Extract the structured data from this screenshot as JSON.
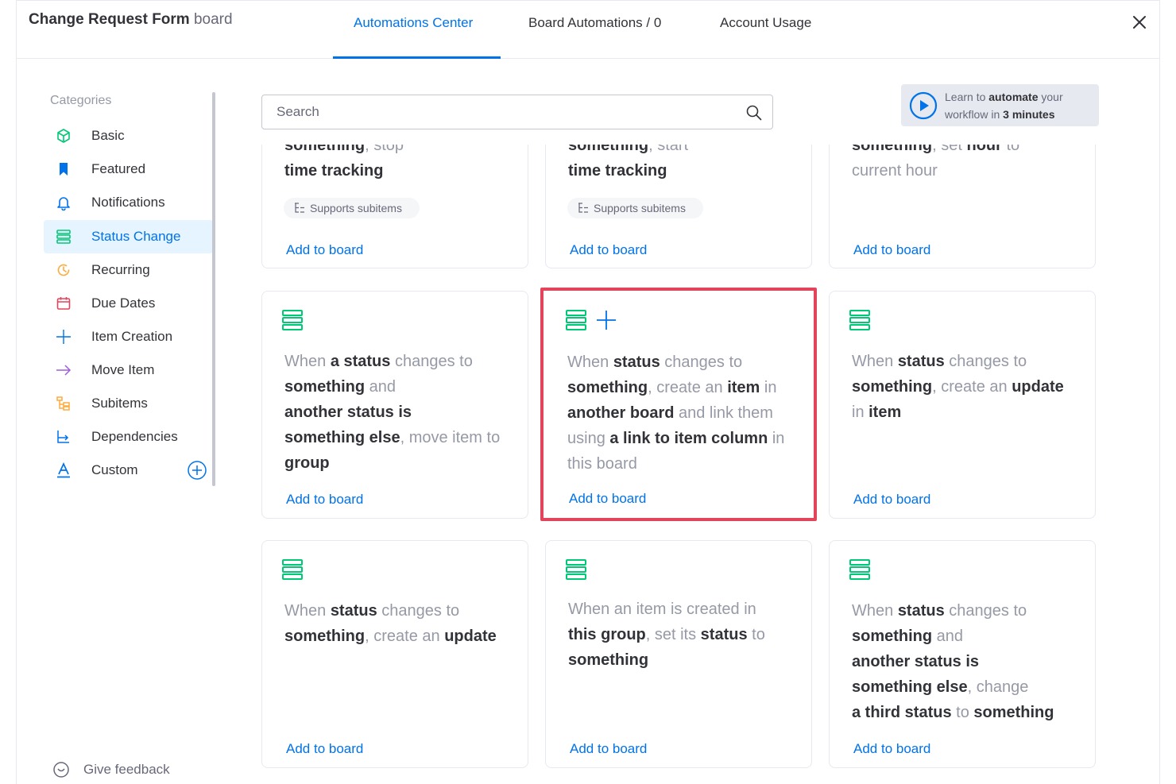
{
  "header": {
    "board_name": "Change Request Form",
    "board_suffix": "board",
    "tabs": [
      {
        "label": "Automations Center",
        "active": true
      },
      {
        "label": "Board Automations / 0",
        "active": false
      },
      {
        "label": "Account Usage",
        "active": false
      }
    ],
    "close_icon": "close-icon"
  },
  "sidebar": {
    "title": "Categories",
    "items": [
      {
        "label": "Basic",
        "icon": "cube-icon",
        "color": "#00c875"
      },
      {
        "label": "Featured",
        "icon": "bookmark-icon",
        "color": "#0073ea"
      },
      {
        "label": "Notifications",
        "icon": "bell-icon",
        "color": "#0073ea"
      },
      {
        "label": "Status Change",
        "icon": "status-stack-icon",
        "color": "#00c875",
        "active": true
      },
      {
        "label": "Recurring",
        "icon": "recurring-clock-icon",
        "color": "#fdab3d"
      },
      {
        "label": "Due Dates",
        "icon": "calendar-icon",
        "color": "#e2445c"
      },
      {
        "label": "Item Creation",
        "icon": "plus-icon",
        "color": "#0073ea"
      },
      {
        "label": "Move Item",
        "icon": "arrow-right-icon",
        "color": "#a25ddc"
      },
      {
        "label": "Subitems",
        "icon": "subitems-icon",
        "color": "#fdab3d"
      },
      {
        "label": "Dependencies",
        "icon": "dependency-icon",
        "color": "#0073ea"
      },
      {
        "label": "Custom",
        "icon": "custom-a-icon",
        "color": "#0073ea"
      }
    ],
    "feedback_label": "Give feedback"
  },
  "search": {
    "placeholder": "Search"
  },
  "learn": {
    "line1_pre": "Learn to ",
    "line1_bold": "automate",
    "line1_post": " your",
    "line2_pre": "workflow in ",
    "line2_bold": "3 minutes"
  },
  "colors": {
    "accent": "#0073ea",
    "green": "#00c875",
    "highlight": "#e2445c"
  },
  "cards": {
    "add_label": "Add to board",
    "chip_label": "Supports subitems",
    "r1c1": {
      "l1a": "something",
      "l1b": ", stop",
      "l2": "time tracking"
    },
    "r1c2": {
      "l1a": "something",
      "l1b": ", start",
      "l2": "time tracking"
    },
    "r1c3": {
      "l1a": "something",
      "l1b": ", set ",
      "l1c": "hour",
      "l1d": " to",
      "l2": "current hour"
    },
    "r2c1": {
      "a": "When ",
      "b": "a status",
      "c": " changes to",
      "d": "something",
      "e": " and",
      "f": "another status is",
      "g": "something else",
      "h": ", move item to",
      "i": "group"
    },
    "r2c2": {
      "a": "When ",
      "b": "status",
      "c": " changes to",
      "d": "something",
      "e": ", create an ",
      "f": "item",
      "g": " in",
      "h": "another board",
      "i": " and link them",
      "j": "using ",
      "k": "a link to item column",
      "l": " in",
      "m": "this board"
    },
    "r2c3": {
      "a": "When ",
      "b": "status",
      "c": " changes to",
      "d": "something",
      "e": ", create an ",
      "f": "update",
      "g": "in ",
      "h": "item"
    },
    "r3c1": {
      "a": "When ",
      "b": "status",
      "c": " changes to",
      "d": "something",
      "e": ", create an ",
      "f": "update"
    },
    "r3c2": {
      "a": "When an item is created in",
      "b": "this group",
      "c": ", set its ",
      "d": "status",
      "e": " to",
      "f": "something"
    },
    "r3c3": {
      "a": "When ",
      "b": "status",
      "c": " changes to",
      "d": "something",
      "e": " and",
      "f": "another status is",
      "g": "something else",
      "h": ", change",
      "i": "a third status",
      "j": " to ",
      "k": "something"
    }
  }
}
